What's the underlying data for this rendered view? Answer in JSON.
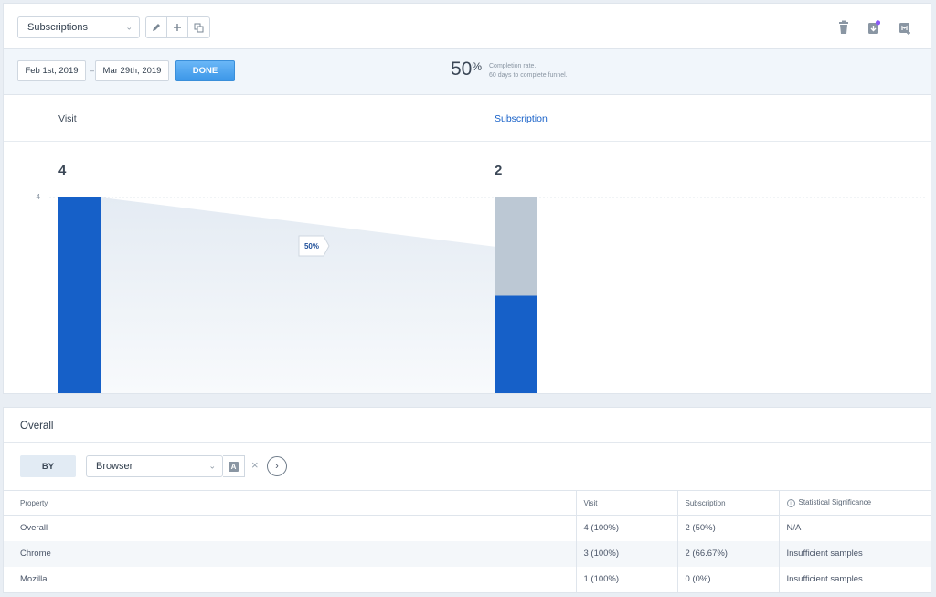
{
  "toolbar": {
    "funnel_select": "Subscriptions",
    "icons": [
      "pencil-icon",
      "plus-icon",
      "duplicate-icon",
      "trash-icon",
      "download-icon",
      "export-icon"
    ],
    "download_badge_color": "#8b5cf6"
  },
  "date_range": {
    "start": "Feb 1st, 2019",
    "separator": "–",
    "end": "Mar 29th, 2019",
    "done_label": "DONE"
  },
  "completion": {
    "value": "50",
    "unit": "%",
    "note_line1": "Completion rate.",
    "note_line2": "60 days to complete funnel."
  },
  "steps": [
    {
      "label": "Visit",
      "count": "4"
    },
    {
      "label": "Subscription",
      "count": "2"
    }
  ],
  "chart_data": {
    "type": "bar",
    "categories": [
      "Visit",
      "Subscription"
    ],
    "values": [
      4,
      2
    ],
    "reference_value": 4,
    "ylim": [
      0,
      4
    ],
    "y_tick_labels": [
      "4"
    ],
    "conversion_labels": [
      "50%"
    ],
    "colors": {
      "bar": "#1660c8",
      "dropoff": "#bcc8d4",
      "flow": "#e8eef5",
      "active_label": "#1660c8"
    }
  },
  "overall": {
    "title": "Overall",
    "by_label": "BY",
    "breakdown_select": "Browser",
    "a_badge": "A",
    "clear_glyph": "×",
    "go_glyph": "›",
    "columns": [
      "Property",
      "Visit",
      "Subscription",
      "Statistical Significance"
    ],
    "info_glyph": "i",
    "rows": [
      {
        "property": "Overall",
        "visit": "4 (100%)",
        "subscription": "2 (50%)",
        "significance": "N/A"
      },
      {
        "property": "Chrome",
        "visit": "3 (100%)",
        "subscription": "2 (66.67%)",
        "significance": "Insufficient samples"
      },
      {
        "property": "Mozilla",
        "visit": "1 (100%)",
        "subscription": "0 (0%)",
        "significance": "Insufficient samples"
      }
    ]
  }
}
